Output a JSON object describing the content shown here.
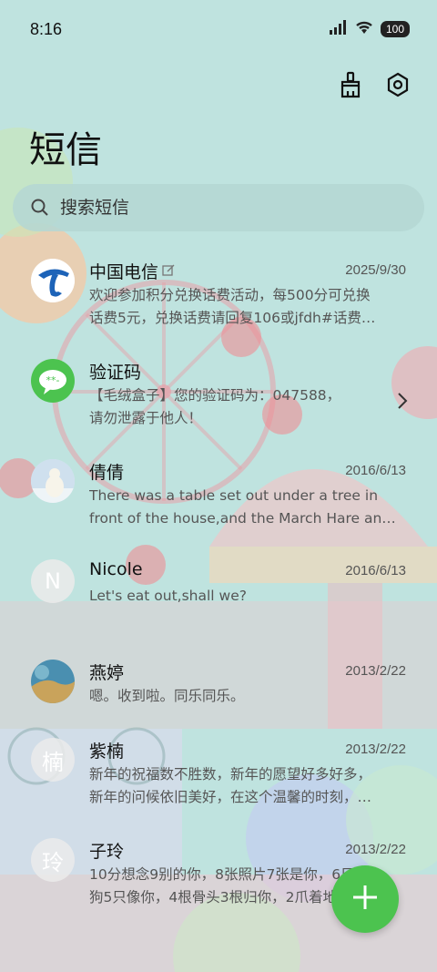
{
  "status": {
    "time": "8:16",
    "battery": "100"
  },
  "header": {
    "title": "短信"
  },
  "search": {
    "placeholder": "搜索短信"
  },
  "conversations": [
    {
      "name": "中国电信",
      "date": "2025/9/30",
      "line1": "欢迎参加积分兑换话费活动，每500分可兑换",
      "line2": "话费5元，兑换话费请回复106或jfdh#话费…",
      "avatar": "china-telecom-logo"
    },
    {
      "name": "验证码",
      "date": "",
      "line1": "【毛绒盒子】您的验证码为：047588，",
      "line2": "请勿泄露于他人！",
      "avatar": "message-bubble-icon"
    },
    {
      "name": "倩倩",
      "date": "2016/6/13",
      "line1": "There was a table set out under a tree in",
      "line2": "front of the house,and the March Hare an…",
      "avatar": "polar-bear-photo"
    },
    {
      "name": "Nicole",
      "date": "2016/6/13",
      "line1": "Let's eat out,shall we?",
      "line2": "",
      "avatar": "N"
    },
    {
      "name": "燕婷",
      "date": "2013/2/22",
      "line1": "嗯。收到啦。同乐同乐。",
      "line2": "",
      "avatar": "landscape-photo"
    },
    {
      "name": "紫楠",
      "date": "2013/2/22",
      "line1": "新年的祝福数不胜数，新年的愿望好多好多，",
      "line2": "新年的问候依旧美好，在这个温馨的时刻，…",
      "avatar": "楠"
    },
    {
      "name": "子玲",
      "date": "2013/2/22",
      "line1": "10分想念9别的你，8张照片7张是你，6只小",
      "line2": "狗5只像你，4根骨头3根归你，2爪着地1定…",
      "avatar": "玲"
    }
  ],
  "colors": {
    "fab": "#4cc34f",
    "telecom_blue": "#1d63b8",
    "background": "#bfe3df"
  }
}
